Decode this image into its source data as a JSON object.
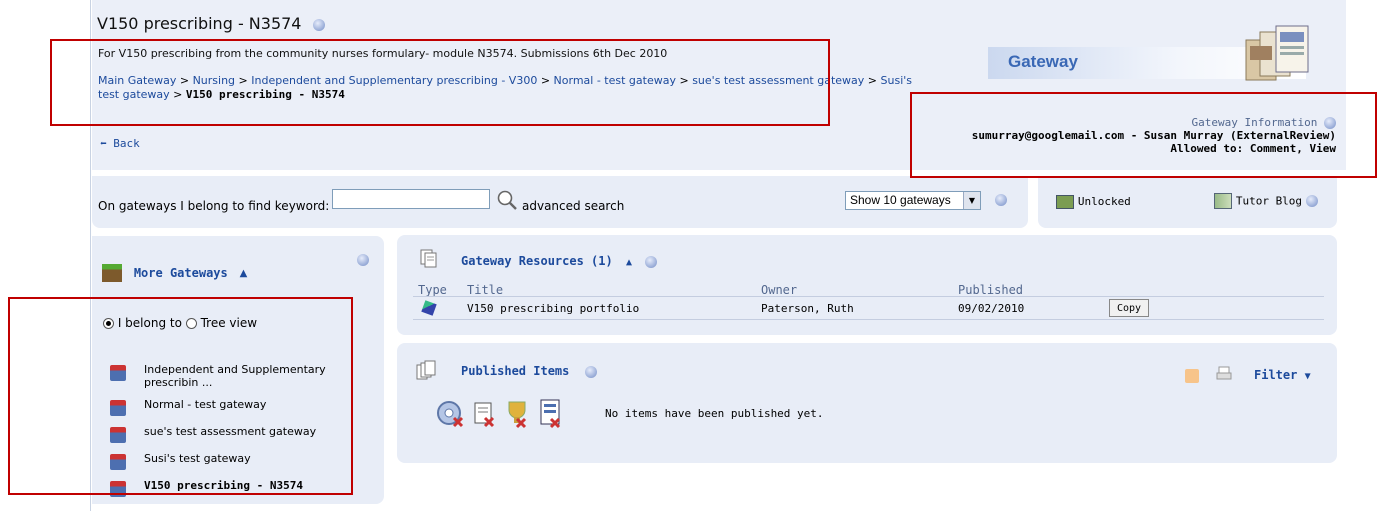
{
  "page": {
    "title": "V150 prescribing - N3574",
    "description": "For V150 prescribing from the community nurses formulary- module N3574. Submissions 6th Dec 2010",
    "breadcrumb": [
      {
        "label": "Main Gateway"
      },
      {
        "label": "Nursing"
      },
      {
        "label": "Independent and Supplementary prescribing - V300"
      },
      {
        "label": "Normal - test gateway"
      },
      {
        "label": "sue's test assessment gateway"
      },
      {
        "label": "Susi's test gateway"
      },
      {
        "label": "V150 prescribing - N3574",
        "current": true
      }
    ],
    "separator": ">",
    "back_label": "Back",
    "logo_text": "Gateway"
  },
  "gateway_info": {
    "heading": "Gateway Information",
    "user_line": "sumurray@googlemail.com - Susan Murray (ExternalReview)",
    "permissions": "Allowed to: Comment, View"
  },
  "search": {
    "label": "On gateways I belong to find keyword:",
    "value": "",
    "advanced_label": "advanced search",
    "show_select": "Show 10 gateways"
  },
  "toolbar_right": {
    "unlocked_label": "Unlocked",
    "blog_label": "Tutor Blog"
  },
  "more_gateways": {
    "heading": "More Gateways",
    "radio_belong": "I belong to",
    "radio_tree": "Tree view",
    "items": [
      {
        "label": "Independent and Supplementary prescribin ..."
      },
      {
        "label": "Normal - test gateway"
      },
      {
        "label": "sue's test assessment gateway"
      },
      {
        "label": "Susi's test gateway"
      },
      {
        "label": "V150 prescribing - N3574",
        "current": true
      }
    ]
  },
  "resources": {
    "heading": "Gateway Resources (1)",
    "columns": [
      "Type",
      "Title",
      "Owner",
      "Published"
    ],
    "rows": [
      {
        "title": "V150 prescribing portfolio",
        "owner": "Paterson, Ruth",
        "published": "09/02/2010",
        "action": "Copy"
      }
    ]
  },
  "published": {
    "heading": "Published Items",
    "empty_text": "No items have been published yet.",
    "filter_label": "Filter"
  },
  "colors": {
    "panel_bg": "#e8edf7",
    "link": "#1c4a9c",
    "highlight_box": "#c00000"
  }
}
